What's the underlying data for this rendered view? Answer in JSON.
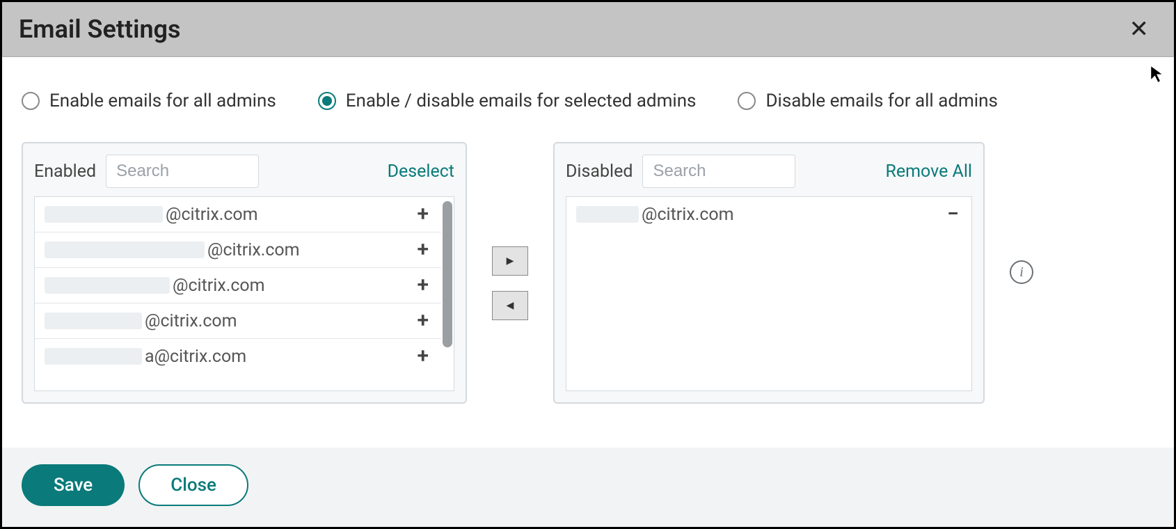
{
  "dialog": {
    "title": "Email Settings"
  },
  "radios": {
    "opt1": "Enable emails for all admins",
    "opt2": "Enable / disable emails for selected admins",
    "opt3": "Disable emails for all admins",
    "selected": "opt2"
  },
  "enabled_panel": {
    "title": "Enabled",
    "search_placeholder": "Search",
    "action": "Deselect",
    "items": [
      {
        "suffix": "@citrix.com"
      },
      {
        "suffix": "@citrix.com"
      },
      {
        "suffix": "@citrix.com"
      },
      {
        "suffix": "@citrix.com"
      },
      {
        "suffix": "a@citrix.com"
      }
    ]
  },
  "disabled_panel": {
    "title": "Disabled",
    "search_placeholder": "Search",
    "action": "Remove All",
    "items": [
      {
        "suffix": "@citrix.com"
      }
    ]
  },
  "glyphs": {
    "plus": "+",
    "minus": "−",
    "arrow_right": "▶",
    "arrow_left": "◀",
    "info": "i",
    "close": "✕"
  },
  "buttons": {
    "save": "Save",
    "close": "Close"
  },
  "accent_color": "#0a7a7a"
}
